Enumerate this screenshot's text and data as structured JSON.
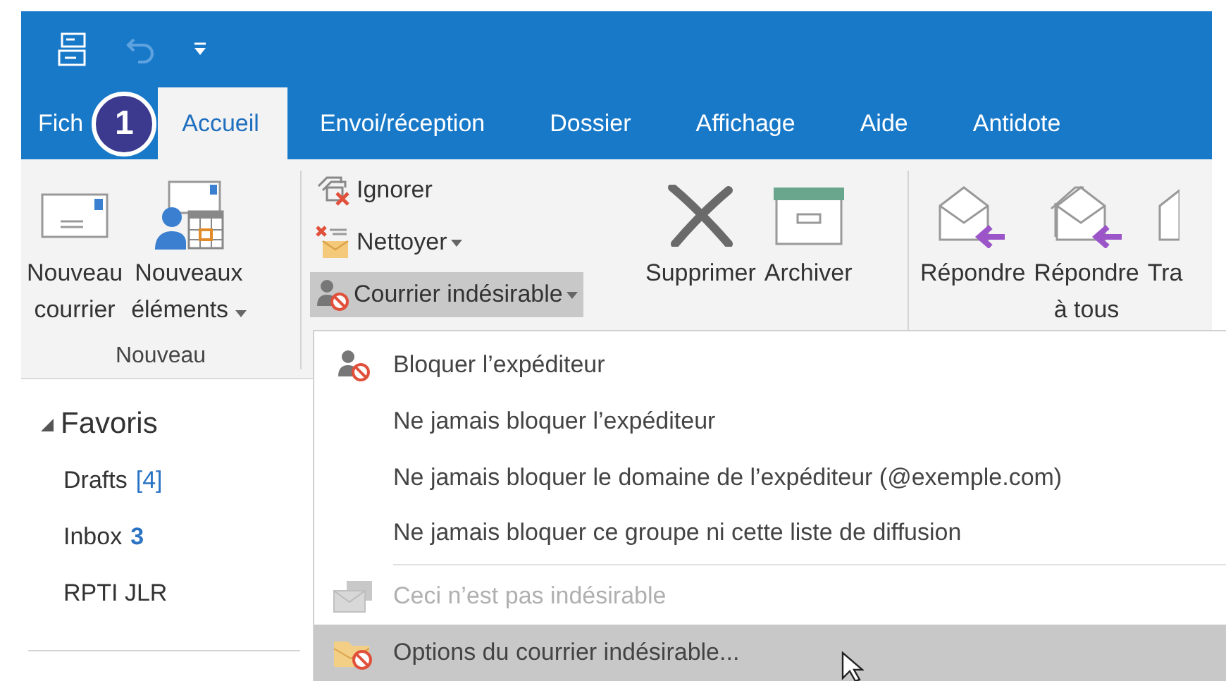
{
  "step_badge": "1",
  "tabs": [
    {
      "label": "Fich",
      "selected": false
    },
    {
      "label": "Accueil",
      "selected": true
    },
    {
      "label": "Envoi/réception",
      "selected": false
    },
    {
      "label": "Dossier",
      "selected": false
    },
    {
      "label": "Affichage",
      "selected": false
    },
    {
      "label": "Aide",
      "selected": false
    },
    {
      "label": "Antidote",
      "selected": false
    }
  ],
  "ribbon": {
    "new_group": {
      "label": "Nouveau",
      "buttons": [
        {
          "kind": "mail",
          "lines": [
            "Nouveau",
            "courrier"
          ],
          "dropdown": false
        },
        {
          "kind": "items",
          "lines": [
            "Nouveaux",
            "éléments"
          ],
          "dropdown": true
        }
      ]
    },
    "small_buttons": [
      {
        "kind": "ignore",
        "label": "Ignorer",
        "dropdown": false,
        "expanded": false
      },
      {
        "kind": "clean",
        "label": "Nettoyer",
        "dropdown": true,
        "expanded": false
      },
      {
        "kind": "junk",
        "label": "Courrier indésirable",
        "dropdown": true,
        "expanded": true
      }
    ],
    "delete_buttons": [
      {
        "kind": "delete",
        "lines": [
          "Supprimer"
        ]
      },
      {
        "kind": "archive",
        "lines": [
          "Archiver"
        ]
      }
    ],
    "respond_buttons": [
      {
        "kind": "reply",
        "lines": [
          "Répondre"
        ]
      },
      {
        "kind": "replyall",
        "lines": [
          "Répondre",
          "à tous"
        ]
      },
      {
        "kind": "cut",
        "lines": [
          "Tra"
        ]
      }
    ]
  },
  "favorites": {
    "title": "Favoris",
    "expanded": true,
    "items": [
      {
        "name": "Drafts",
        "count": "[4]",
        "count_bold": false
      },
      {
        "name": "Inbox",
        "count": "3",
        "count_bold": true
      },
      {
        "name": "RPTI JLR"
      }
    ]
  },
  "junk_menu": [
    {
      "kind": "block",
      "label": "Bloquer l’expéditeur",
      "disabled": false,
      "selected": false
    },
    {
      "kind": "plain",
      "label": "Ne jamais bloquer l’expéditeur",
      "disabled": false,
      "selected": false
    },
    {
      "kind": "plain",
      "label": "Ne jamais bloquer le domaine de l’expéditeur (@exemple.com)",
      "disabled": false,
      "selected": false
    },
    {
      "kind": "plain",
      "label": "Ne jamais bloquer ce groupe ni cette liste de diffusion",
      "disabled": false,
      "selected": false
    },
    {
      "kind": "separator"
    },
    {
      "kind": "notjunk",
      "label": "Ceci n’est pas indésirable",
      "disabled": true,
      "selected": false
    },
    {
      "kind": "options",
      "label": "Options du courrier indésirable...",
      "disabled": false,
      "selected": true
    }
  ]
}
